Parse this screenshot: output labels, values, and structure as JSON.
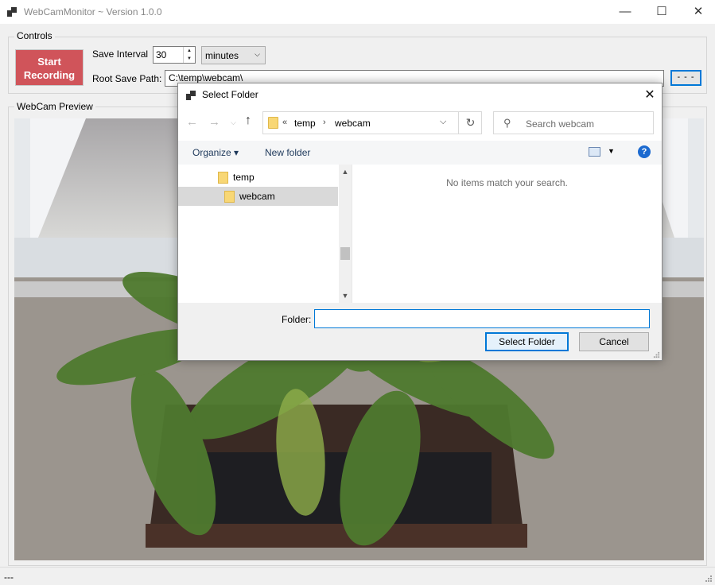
{
  "window": {
    "title": "WebCamMonitor ~ Version 1.0.0",
    "minimize_glyph": "—",
    "maximize_glyph": "☐",
    "close_glyph": "✕"
  },
  "controls": {
    "group_label": "Controls",
    "start_button_line1": "Start",
    "start_button_line2": "Recording",
    "start_button_color": "#d0545a",
    "save_interval_label": "Save Interval",
    "save_interval_value": "30",
    "interval_unit": "minutes",
    "root_path_label": "Root Save Path:",
    "root_path_value": "C:\\temp\\webcam\\",
    "browse_button": "- - -"
  },
  "preview": {
    "group_label": "WebCam Preview"
  },
  "statusbar": {
    "text": "---"
  },
  "dialog": {
    "title": "Select Folder",
    "close_glyph": "✕",
    "address": {
      "overflow": "«",
      "segments": [
        "temp",
        "webcam"
      ]
    },
    "search_placeholder": "Search webcam",
    "commands": {
      "organize": "Organize ▾",
      "new_folder": "New folder",
      "help": "?"
    },
    "tree": [
      {
        "label": "temp",
        "selected": false
      },
      {
        "label": "webcam",
        "selected": true
      }
    ],
    "empty_message": "No items match your search.",
    "folder_label": "Folder:",
    "folder_value": "",
    "select_button": "Select Folder",
    "cancel_button": "Cancel",
    "accent_color": "#0078d7"
  }
}
